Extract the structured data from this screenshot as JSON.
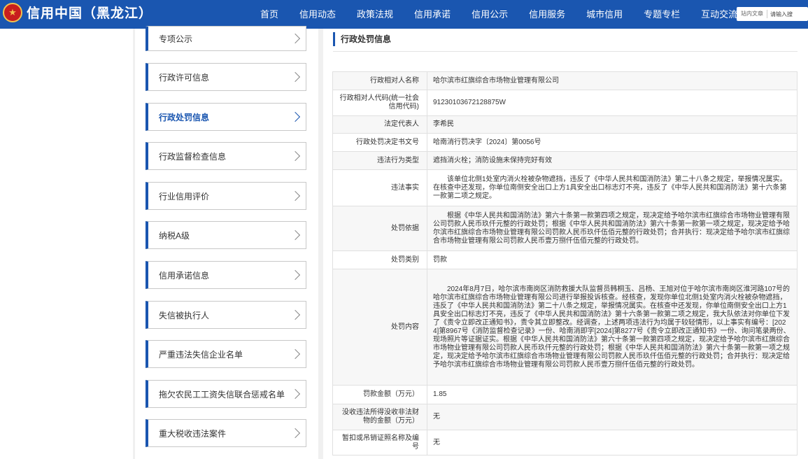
{
  "header": {
    "title": "信用中国（黑龙江）",
    "nav": [
      "首页",
      "信用动态",
      "政策法规",
      "信用承诺",
      "信用公示",
      "信用服务",
      "城市信用",
      "专题专栏",
      "互动交流"
    ],
    "search_category": "站内文章",
    "search_placeholder": "请输入搜"
  },
  "sidebar": {
    "items": [
      {
        "label": "专项公示"
      },
      {
        "label": "行政许可信息"
      },
      {
        "label": "行政处罚信息"
      },
      {
        "label": "行政监督检查信息"
      },
      {
        "label": "行业信用评价"
      },
      {
        "label": "纳税A级"
      },
      {
        "label": "信用承诺信息"
      },
      {
        "label": "失信被执行人"
      },
      {
        "label": "严重违法失信企业名单"
      },
      {
        "label": "拖欠农民工工资失信联合惩戒名单"
      },
      {
        "label": "重大税收违法案件"
      }
    ],
    "active_index": 2
  },
  "main": {
    "section_title": "行政处罚信息",
    "rows": [
      {
        "label": "行政相对人名称",
        "value": "哈尔滨市红旗综合市场物业管理有限公司"
      },
      {
        "label": "行政相对人代码(统一社会信用代码)",
        "value": "91230103672128875W"
      },
      {
        "label": "法定代表人",
        "value": "李希民"
      },
      {
        "label": "行政处罚决定书文号",
        "value": "哈南消行罚决字〔2024〕第0056号"
      },
      {
        "label": "违法行为类型",
        "value": "遮挡消火栓；消防设施未保持完好有效"
      },
      {
        "label": "违法事实",
        "value": "该单位北侧1处室内消火栓被杂物遮挡，违反了《中华人民共和国消防法》第二十八条之规定，举报情况属实。在核查中还发现，你单位南侧安全出口上方1具安全出口标志灯不亮，违反了《中华人民共和国消防法》第十六条第一款第二项之规定。"
      },
      {
        "label": "处罚依据",
        "value": "根据《中华人民共和国消防法》第六十条第一款第四项之规定，现决定给予哈尔滨市红旗综合市场物业管理有限公司罚款人民币玖仟元整的行政处罚；根据《中华人民共和国消防法》第六十条第一款第一项之规定，现决定给予哈尔滨市红旗综合市场物业管理有限公司罚款人民币玖仟伍佰元整的行政处罚；合并执行：现决定给予哈尔滨市红旗综合市场物业管理有限公司罚款人民币壹万捌仟伍佰元整的行政处罚。"
      },
      {
        "label": "处罚类别",
        "value": "罚款"
      },
      {
        "label": "处罚内容",
        "value": "2024年8月7日，哈尔滨市南岗区消防救援大队监督员韩桐玉、吕杨、王旭对位于哈尔滨市南岗区淮河路107号的哈尔滨市红旗综合市场物业管理有限公司进行举报投诉核查。经核查，发现你单位北侧1处室内消火栓被杂物遮挡，违反了《中华人民共和国消防法》第二十八条之规定，举报情况属实。在核查中还发现，你单位南侧安全出口上方1具安全出口标志灯不亮，违反了《中华人民共和国消防法》第十六条第一款第二项之规定，我大队依法对你单位下发了《责令立即改正通知书》，责令其立即整改。经调查，上述两项违法行为均属于较轻情形，以上事实有编号：[2024]第8967号《消防监督检查记录》一份、哈南消即字[2024]第8277号《责令立即改正通知书》一份、询问笔录两份、现场照片等证据证实。根据《中华人民共和国消防法》第六十条第一款第四项之规定，现决定给予哈尔滨市红旗综合市场物业管理有限公司罚款人民币玖仟元整的行政处罚；根据《中华人民共和国消防法》第六十条第一款第一项之规定，现决定给予哈尔滨市红旗综合市场物业管理有限公司罚款人民币玖仟伍佰元整的行政处罚；合并执行：现决定给予哈尔滨市红旗综合市场物业管理有限公司罚款人民币壹万捌仟伍佰元整的行政处罚。"
      },
      {
        "label": "罚款金额（万元）",
        "value": "1.85"
      },
      {
        "label": "没收违法所得没收非法财物的金额（万元）",
        "value": "无"
      },
      {
        "label": "暂扣或吊销证照名称及编号",
        "value": "无"
      }
    ]
  },
  "colors": {
    "header_bg": "#1a56b0",
    "accent": "#1a56b0"
  }
}
